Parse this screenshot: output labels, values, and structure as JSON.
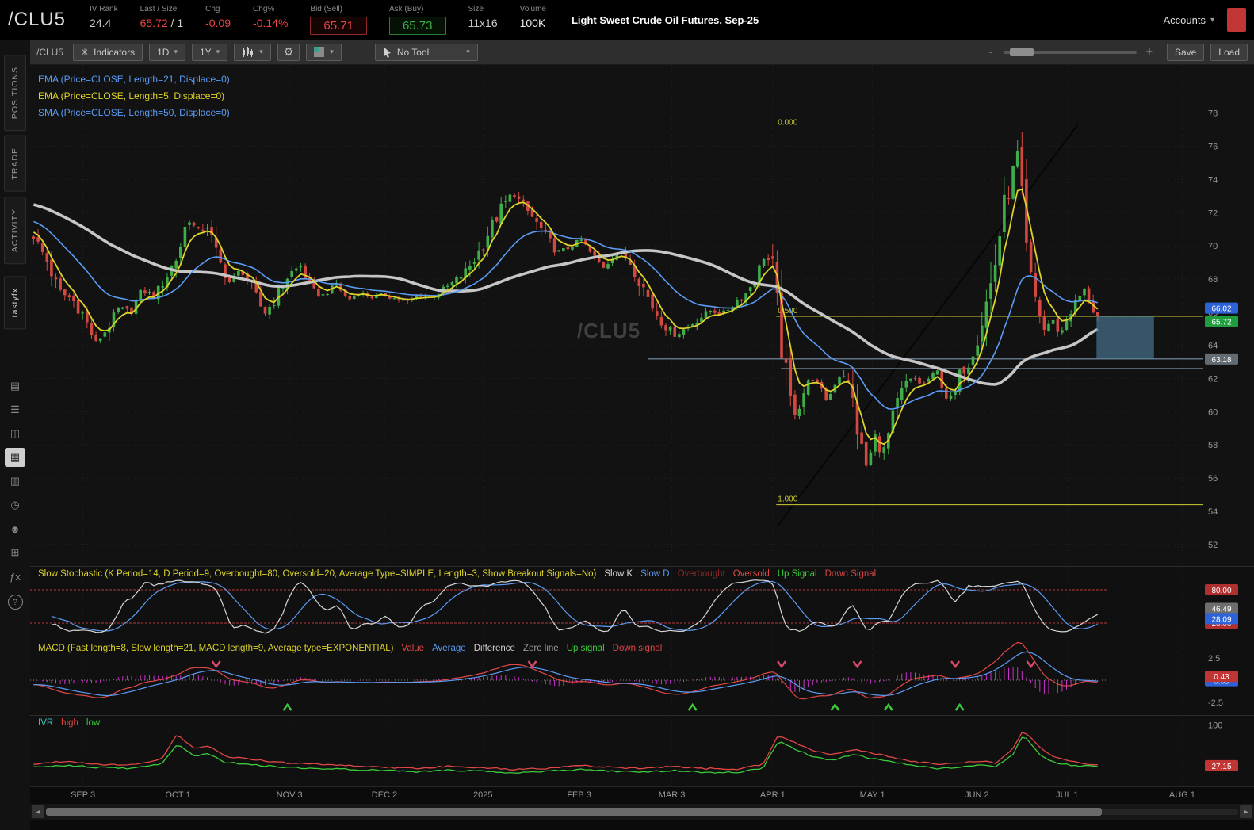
{
  "header": {
    "symbol": "/CLU5",
    "fields": [
      {
        "name": "iv-rank",
        "label": "IV Rank",
        "value": "24.4",
        "color": "#cfcfcf",
        "interactable": false
      },
      {
        "name": "last-size",
        "label": "Last / Size",
        "value": "65.72",
        "suffix": " / 1",
        "color": "#e84545",
        "interactable": false
      },
      {
        "name": "change",
        "label": "Chg",
        "value": "-0.09",
        "color": "#e84545",
        "interactable": false
      },
      {
        "name": "change-pct",
        "label": "Chg%",
        "value": "-0.14%",
        "color": "#e84545",
        "interactable": false
      },
      {
        "name": "bid",
        "label": "Bid (Sell)",
        "value": "65.71",
        "color": "#e84545",
        "boxed": "red",
        "interactable": true
      },
      {
        "name": "ask",
        "label": "Ask (Buy)",
        "value": "65.73",
        "color": "#3fae49",
        "boxed": "green",
        "interactable": true
      },
      {
        "name": "size",
        "label": "Size",
        "value": "11x16",
        "color": "#c8c8c8",
        "interactable": false
      },
      {
        "name": "volume",
        "label": "Volume",
        "value": "100K",
        "color": "#ededed",
        "interactable": false
      }
    ],
    "description": "Light Sweet Crude Oil Futures, Sep-25",
    "accounts_label": "Accounts"
  },
  "sidebar": {
    "tabs": [
      {
        "name": "positions",
        "label": "POSITIONS"
      },
      {
        "name": "trade",
        "label": "TRADE"
      },
      {
        "name": "activity",
        "label": "ACTIVITY"
      },
      {
        "name": "tastyfx",
        "label": "tastyfx",
        "alt": true
      }
    ],
    "icons": [
      {
        "name": "quotes-icon",
        "glyph": "▤"
      },
      {
        "name": "watchlist-icon",
        "glyph": "☰"
      },
      {
        "name": "platform-icon",
        "glyph": "◫"
      },
      {
        "name": "chart-icon",
        "glyph": "▦",
        "active": true
      },
      {
        "name": "grid-icon",
        "glyph": "▥"
      },
      {
        "name": "history-icon",
        "glyph": "◷"
      },
      {
        "name": "contacts-icon",
        "glyph": "☻"
      },
      {
        "name": "calendar-icon",
        "glyph": "⊞"
      },
      {
        "name": "fx-icon",
        "glyph": "ƒx"
      },
      {
        "name": "help-icon",
        "glyph": "?",
        "help": true
      }
    ]
  },
  "toolbar": {
    "symbol_label": "/CLU5",
    "indicators_label": "Indicators",
    "timeframe": "1D",
    "range": "1Y",
    "tool_label": "No Tool",
    "zoom_minus": "-",
    "zoom_plus": "+",
    "save_label": "Save",
    "load_label": "Load"
  },
  "watermark": "/CLU5",
  "legends": {
    "price": [
      {
        "text": "EMA (Price=CLOSE, Length=21, Displace=0)",
        "color": "#5b9cf5"
      },
      {
        "text": "EMA (Price=CLOSE, Length=5, Displace=0)",
        "color": "#ddd42a"
      },
      {
        "text": "SMA (Price=CLOSE, Length=50, Displace=0)",
        "color": "#5b9cf5"
      }
    ],
    "stochastic": [
      {
        "text": "Slow Stochastic (K Period=14, D Period=9, Overbought=80, Oversold=20, Average Type=SIMPLE, Length=3, Show Breakout Signals=No)",
        "color": "#ddd42a"
      },
      {
        "text": "Slow K",
        "color": "#d8d8d8"
      },
      {
        "text": "Slow D",
        "color": "#5b9cf5"
      },
      {
        "text": "Overbought",
        "color": "#8b2a2a"
      },
      {
        "text": "Oversold",
        "color": "#e04848"
      },
      {
        "text": "Up Signal",
        "color": "#3bcc3b"
      },
      {
        "text": "Down Signal",
        "color": "#d94848"
      }
    ],
    "macd": [
      {
        "text": "MACD (Fast length=8, Slow length=21, MACD length=9, Average type=EXPONENTIAL)",
        "color": "#ddd42a"
      },
      {
        "text": "Value",
        "color": "#e04848"
      },
      {
        "text": "Average",
        "color": "#5b9cf5"
      },
      {
        "text": "Difference",
        "color": "#cfcfcf"
      },
      {
        "text": "Zero line",
        "color": "#9a9a9a"
      },
      {
        "text": "Up signal",
        "color": "#3bcc3b"
      },
      {
        "text": "Down signal",
        "color": "#d94848"
      }
    ],
    "ivr": [
      {
        "text": "IVR",
        "color": "#35c8c8"
      },
      {
        "text": "high",
        "color": "#e04848"
      },
      {
        "text": "low",
        "color": "#3bcc3b"
      }
    ]
  },
  "chart_data": {
    "type": "candlestick",
    "symbol": "/CLU5",
    "title": "Light Sweet Crude Oil Futures Sep-25, 1Y daily with EMA5/EMA21/SMA50, Slow Stochastic, MACD, IVR",
    "price": {
      "ylim": [
        50.7,
        80.9
      ],
      "y_ticks": [
        78,
        76,
        74,
        72,
        70,
        68,
        66,
        64,
        62,
        60,
        58,
        56,
        54,
        52
      ],
      "num_candles": 240,
      "candle_span": [
        0.003,
        0.91
      ],
      "last_close": 65.72,
      "path_anchors": [
        [
          0.0,
          70.6
        ],
        [
          0.013,
          69.0
        ],
        [
          0.024,
          67.2
        ],
        [
          0.036,
          66.8
        ],
        [
          0.047,
          65.8
        ],
        [
          0.058,
          64.1
        ],
        [
          0.069,
          65.0
        ],
        [
          0.08,
          66.2
        ],
        [
          0.091,
          66.0
        ],
        [
          0.102,
          67.3
        ],
        [
          0.114,
          67.0
        ],
        [
          0.125,
          68.2
        ],
        [
          0.136,
          69.5
        ],
        [
          0.145,
          71.8
        ],
        [
          0.154,
          70.8
        ],
        [
          0.163,
          71.3
        ],
        [
          0.173,
          69.2
        ],
        [
          0.184,
          67.8
        ],
        [
          0.195,
          68.6
        ],
        [
          0.206,
          67.3
        ],
        [
          0.217,
          65.9
        ],
        [
          0.229,
          67.0
        ],
        [
          0.24,
          68.3
        ],
        [
          0.251,
          68.8
        ],
        [
          0.262,
          67.2
        ],
        [
          0.273,
          67.0
        ],
        [
          0.284,
          67.8
        ],
        [
          0.295,
          66.7
        ],
        [
          0.306,
          67.2
        ],
        [
          0.318,
          66.9
        ],
        [
          0.329,
          67.1
        ],
        [
          0.34,
          66.8
        ],
        [
          0.351,
          66.6
        ],
        [
          0.362,
          67.0
        ],
        [
          0.373,
          66.9
        ],
        [
          0.384,
          67.3
        ],
        [
          0.395,
          67.8
        ],
        [
          0.407,
          68.5
        ],
        [
          0.418,
          69.6
        ],
        [
          0.429,
          71.0
        ],
        [
          0.44,
          72.3
        ],
        [
          0.45,
          73.2
        ],
        [
          0.458,
          72.6
        ],
        [
          0.47,
          71.6
        ],
        [
          0.481,
          70.6
        ],
        [
          0.492,
          69.6
        ],
        [
          0.503,
          69.9
        ],
        [
          0.514,
          70.4
        ],
        [
          0.525,
          69.4
        ],
        [
          0.536,
          68.7
        ],
        [
          0.547,
          69.6
        ],
        [
          0.559,
          69.2
        ],
        [
          0.57,
          67.9
        ],
        [
          0.581,
          66.4
        ],
        [
          0.592,
          65.3
        ],
        [
          0.603,
          64.6
        ],
        [
          0.614,
          65.1
        ],
        [
          0.625,
          65.6
        ],
        [
          0.636,
          66.1
        ],
        [
          0.648,
          65.9
        ],
        [
          0.659,
          66.6
        ],
        [
          0.67,
          67.2
        ],
        [
          0.679,
          68.2
        ],
        [
          0.687,
          69.4
        ],
        [
          0.694,
          68.8
        ],
        [
          0.702,
          64.5
        ],
        [
          0.709,
          61.0
        ],
        [
          0.717,
          59.8
        ],
        [
          0.724,
          61.2
        ],
        [
          0.731,
          62.1
        ],
        [
          0.739,
          61.4
        ],
        [
          0.746,
          60.6
        ],
        [
          0.754,
          61.9
        ],
        [
          0.761,
          62.4
        ],
        [
          0.769,
          60.9
        ],
        [
          0.776,
          58.3
        ],
        [
          0.783,
          56.6
        ],
        [
          0.791,
          58.6
        ],
        [
          0.798,
          57.4
        ],
        [
          0.806,
          59.2
        ],
        [
          0.813,
          60.7
        ],
        [
          0.82,
          61.7
        ],
        [
          0.828,
          62.0
        ],
        [
          0.835,
          61.6
        ],
        [
          0.843,
          62.1
        ],
        [
          0.85,
          62.4
        ],
        [
          0.857,
          60.9
        ],
        [
          0.865,
          60.8
        ],
        [
          0.872,
          62.6
        ],
        [
          0.879,
          63.1
        ],
        [
          0.887,
          64.6
        ],
        [
          0.894,
          66.2
        ],
        [
          0.902,
          68.3
        ],
        [
          0.909,
          71.2
        ],
        [
          0.917,
          73.6
        ],
        [
          0.924,
          75.8
        ],
        [
          0.929,
          72.5
        ],
        [
          0.935,
          68.2
        ],
        [
          0.943,
          66.4
        ],
        [
          0.95,
          64.9
        ],
        [
          0.957,
          65.6
        ],
        [
          0.965,
          64.6
        ],
        [
          0.972,
          65.9
        ],
        [
          0.98,
          66.6
        ],
        [
          0.987,
          67.4
        ],
        [
          0.994,
          66.3
        ],
        [
          1.0,
          65.72
        ]
      ],
      "colors": {
        "up": "#3fae49",
        "down": "#d34840",
        "ema21": "#5b9cf5",
        "ema5": "#ddd42a",
        "sma50": "#c6c6c6"
      },
      "fib": {
        "start_frac": 0.636,
        "color": "#cfcf30",
        "levels": [
          {
            "label": "0.000",
            "price": 77.1
          },
          {
            "label": "0.500",
            "price": 65.75
          },
          {
            "label": "1.000",
            "price": 54.4
          }
        ]
      },
      "hlines": [
        {
          "price": 63.18,
          "start_frac": 0.527,
          "color": "#7d96ad",
          "badge": {
            "text": "63.18",
            "bg": "#636b73"
          }
        },
        {
          "price": 62.6,
          "start_frac": 0.64,
          "color": "#7d96ad"
        }
      ],
      "trendline": {
        "x1": 0.638,
        "p1": 53.2,
        "x2": 0.893,
        "p2": 77.3,
        "color": "#060606",
        "width": 2
      },
      "zone": {
        "x1": 0.909,
        "x2": 0.958,
        "p_top": 65.75,
        "p_bottom": 63.18,
        "fill": "#4d7f9e",
        "opacity": 0.62
      },
      "price_badges": [
        {
          "text": "66.02",
          "bg": "#2d62d9",
          "price": 66.25
        },
        {
          "text": "65.72",
          "bg": "#1e9e3e",
          "price": 65.45
        }
      ]
    },
    "stochastic": {
      "k_period": 14,
      "d_period": 9,
      "overbought": 80,
      "oversold": 20,
      "average_type": "SIMPLE",
      "length": 3,
      "line_colors": {
        "k": "#d8d8d8",
        "d": "#5b9cf5",
        "bands": "#b33b3b"
      },
      "axis_badges": [
        {
          "text": "80.00",
          "bg": "#b03030",
          "value": 80
        },
        {
          "text": "46.49",
          "bg": "#6e6e6e",
          "value": 46.49
        },
        {
          "text": "20.00",
          "bg": "#b03030",
          "value": 20
        },
        {
          "text": "28.09",
          "bg": "#2d62d9",
          "value": 28.09
        }
      ]
    },
    "macd": {
      "fast": 8,
      "slow": 21,
      "signal": 9,
      "ylim": [
        -3.2,
        3.2
      ],
      "axis_labels": [
        {
          "text": "2.5",
          "value": 2.5
        },
        {
          "text": "-2.5",
          "value": -2.5
        }
      ],
      "badges": [
        {
          "text": "0.35",
          "bg": "#2d62d9",
          "value": -0.05
        },
        {
          "text": "0.43",
          "bg": "#c23535",
          "value": 0.43
        }
      ],
      "colors": {
        "value": "#e04848",
        "average": "#5b9cf5",
        "histogram": "#cc33cc",
        "zero": "#8a8a8a",
        "up": "#3bcc3b",
        "down": "#d94868"
      }
    },
    "ivr": {
      "ylim": [
        0,
        105
      ],
      "axis_label_top": "100",
      "badge": {
        "text": "27.15",
        "bg": "#c23535",
        "value": 27.15
      },
      "high_color": "#e04848",
      "low_color": "#3bcc3b",
      "high_anchors": [
        [
          0,
          30
        ],
        [
          0.03,
          36
        ],
        [
          0.06,
          30
        ],
        [
          0.09,
          28
        ],
        [
          0.12,
          40
        ],
        [
          0.135,
          86
        ],
        [
          0.15,
          60
        ],
        [
          0.165,
          66
        ],
        [
          0.18,
          45
        ],
        [
          0.21,
          38
        ],
        [
          0.24,
          32
        ],
        [
          0.27,
          30
        ],
        [
          0.3,
          27
        ],
        [
          0.33,
          24
        ],
        [
          0.36,
          22
        ],
        [
          0.39,
          26
        ],
        [
          0.42,
          24
        ],
        [
          0.45,
          20
        ],
        [
          0.48,
          22
        ],
        [
          0.51,
          28
        ],
        [
          0.54,
          24
        ],
        [
          0.57,
          22
        ],
        [
          0.6,
          26
        ],
        [
          0.63,
          22
        ],
        [
          0.66,
          20
        ],
        [
          0.685,
          30
        ],
        [
          0.7,
          85
        ],
        [
          0.715,
          72
        ],
        [
          0.73,
          58
        ],
        [
          0.75,
          48
        ],
        [
          0.77,
          58
        ],
        [
          0.79,
          50
        ],
        [
          0.81,
          42
        ],
        [
          0.83,
          34
        ],
        [
          0.85,
          30
        ],
        [
          0.87,
          32
        ],
        [
          0.89,
          36
        ],
        [
          0.905,
          32
        ],
        [
          0.92,
          60
        ],
        [
          0.93,
          95
        ],
        [
          0.945,
          62
        ],
        [
          0.96,
          42
        ],
        [
          0.975,
          35
        ],
        [
          0.99,
          30
        ],
        [
          1,
          28
        ]
      ],
      "low_anchors": [
        [
          0,
          24
        ],
        [
          0.03,
          28
        ],
        [
          0.06,
          24
        ],
        [
          0.09,
          22
        ],
        [
          0.12,
          30
        ],
        [
          0.135,
          68
        ],
        [
          0.15,
          46
        ],
        [
          0.165,
          50
        ],
        [
          0.18,
          34
        ],
        [
          0.21,
          28
        ],
        [
          0.24,
          24
        ],
        [
          0.27,
          22
        ],
        [
          0.3,
          20
        ],
        [
          0.33,
          18
        ],
        [
          0.36,
          16
        ],
        [
          0.39,
          19
        ],
        [
          0.42,
          17
        ],
        [
          0.45,
          14
        ],
        [
          0.48,
          16
        ],
        [
          0.51,
          20
        ],
        [
          0.54,
          17
        ],
        [
          0.57,
          15
        ],
        [
          0.6,
          18
        ],
        [
          0.63,
          15
        ],
        [
          0.66,
          14
        ],
        [
          0.685,
          22
        ],
        [
          0.7,
          74
        ],
        [
          0.715,
          60
        ],
        [
          0.73,
          46
        ],
        [
          0.75,
          38
        ],
        [
          0.77,
          48
        ],
        [
          0.79,
          40
        ],
        [
          0.81,
          33
        ],
        [
          0.83,
          26
        ],
        [
          0.85,
          22
        ],
        [
          0.87,
          24
        ],
        [
          0.89,
          28
        ],
        [
          0.905,
          25
        ],
        [
          0.92,
          48
        ],
        [
          0.93,
          86
        ],
        [
          0.945,
          48
        ],
        [
          0.96,
          32
        ],
        [
          0.975,
          28
        ],
        [
          0.99,
          26
        ],
        [
          1,
          27
        ]
      ]
    },
    "x_axis": {
      "labels": [
        {
          "text": "SEP 3",
          "frac": 0.045
        },
        {
          "text": "OCT 1",
          "frac": 0.126
        },
        {
          "text": "NOV 3",
          "frac": 0.221
        },
        {
          "text": "DEC 2",
          "frac": 0.302
        },
        {
          "text": "2025",
          "frac": 0.386
        },
        {
          "text": "FEB 3",
          "frac": 0.468
        },
        {
          "text": "MAR 3",
          "frac": 0.547
        },
        {
          "text": "APR 1",
          "frac": 0.633
        },
        {
          "text": "MAY 1",
          "frac": 0.718
        },
        {
          "text": "JUN 2",
          "frac": 0.807
        },
        {
          "text": "JUL 1",
          "frac": 0.884
        },
        {
          "text": "AUG 1",
          "frac": 0.982
        }
      ]
    }
  }
}
